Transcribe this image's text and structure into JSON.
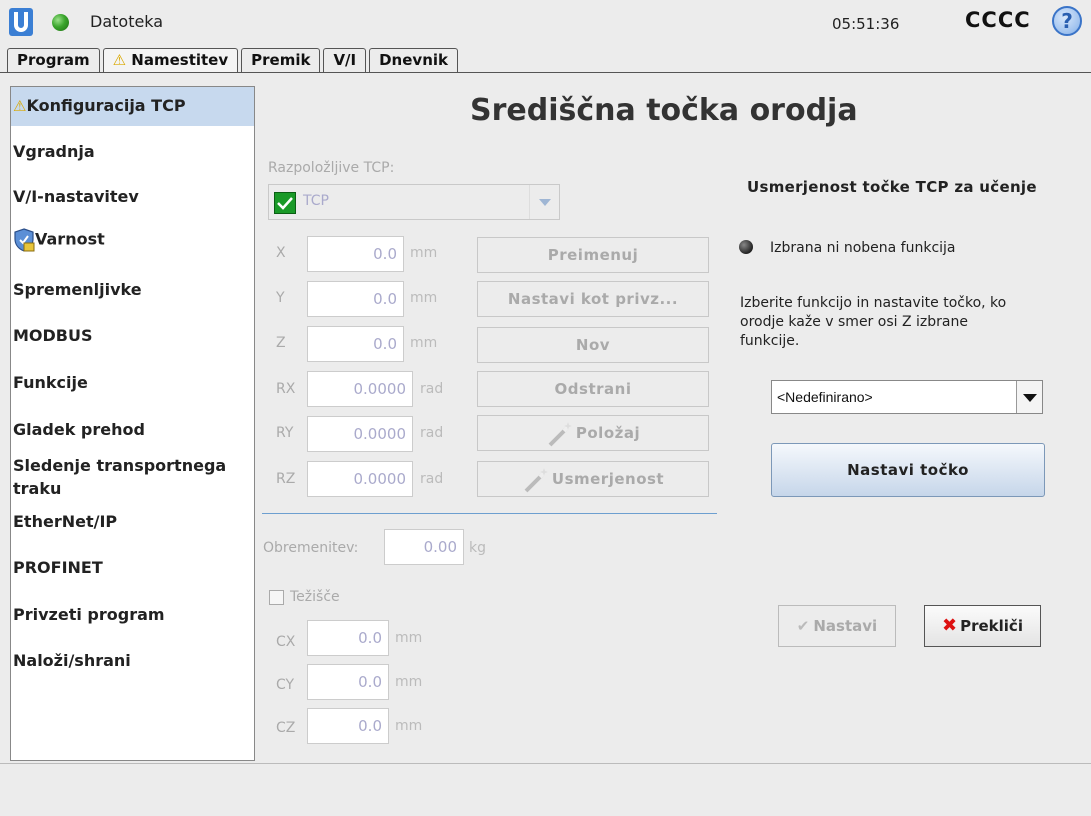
{
  "topbar": {
    "logo": "ur-logo-icon",
    "file_label": "Datoteka",
    "time": "05:51:36",
    "robot_name": "CCCC",
    "help_glyph": "?"
  },
  "tabs": [
    {
      "label": "Program",
      "warning": false
    },
    {
      "label": "Namestitev",
      "warning": true,
      "active": true
    },
    {
      "label": "Premik",
      "warning": false
    },
    {
      "label": "V/I",
      "warning": false
    },
    {
      "label": "Dnevnik",
      "warning": false
    }
  ],
  "sidebar": {
    "items": [
      {
        "label": "Konfiguracija TCP",
        "selected": true,
        "icon": "warning-icon"
      },
      {
        "label": "Vgradnja"
      },
      {
        "label": "V/I-nastavitev"
      },
      {
        "label": "Varnost",
        "icon": "shield-icon"
      },
      {
        "label": "Spremenljivke"
      },
      {
        "label": "MODBUS"
      },
      {
        "label": "Funkcije"
      },
      {
        "label": "Gladek prehod"
      },
      {
        "label": "Sledenje transportnega traku"
      },
      {
        "label": "EtherNet/IP"
      },
      {
        "label": "PROFINET"
      },
      {
        "label": "Privzeti program"
      },
      {
        "label": "Naloži/shrani"
      }
    ]
  },
  "main": {
    "title": "Središčna točka orodja",
    "available_tcp_label": "Razpoložljive TCP:",
    "tcp_selected": "TCP",
    "coords": [
      {
        "label": "X",
        "value": "0.0",
        "unit": "mm"
      },
      {
        "label": "Y",
        "value": "0.0",
        "unit": "mm"
      },
      {
        "label": "Z",
        "value": "0.0",
        "unit": "mm"
      },
      {
        "label": "RX",
        "value": "0.0000",
        "unit": "rad"
      },
      {
        "label": "RY",
        "value": "0.0000",
        "unit": "rad"
      },
      {
        "label": "RZ",
        "value": "0.0000",
        "unit": "rad"
      }
    ],
    "buttons": {
      "rename": "Preimenuj",
      "set_default": "Nastavi kot privz...",
      "new": "Nov",
      "remove": "Odstrani",
      "position": "Položaj",
      "orientation": "Usmerjenost"
    },
    "payload_label": "Obremenitev:",
    "payload_value": "0.00",
    "payload_unit": "kg",
    "cog_label": "Težišče",
    "cog": [
      {
        "label": "CX",
        "value": "0.0",
        "unit": "mm"
      },
      {
        "label": "CY",
        "value": "0.0",
        "unit": "mm"
      },
      {
        "label": "CZ",
        "value": "0.0",
        "unit": "mm"
      }
    ]
  },
  "right": {
    "heading": "Usmerjenost točke TCP za učenje",
    "selected_feature": "Izbrana ni nobena funkcija",
    "instructions_1": "Izberite funkcijo in nastavite točko, ko",
    "instructions_2": "orodje kaže v smer osi Z izbrane",
    "instructions_3": "funkcije.",
    "feature_dropdown": "<Nedefinirano>",
    "set_point_button": "Nastavi točko",
    "apply_button": "Nastavi",
    "cancel_button": "Prekliči"
  }
}
